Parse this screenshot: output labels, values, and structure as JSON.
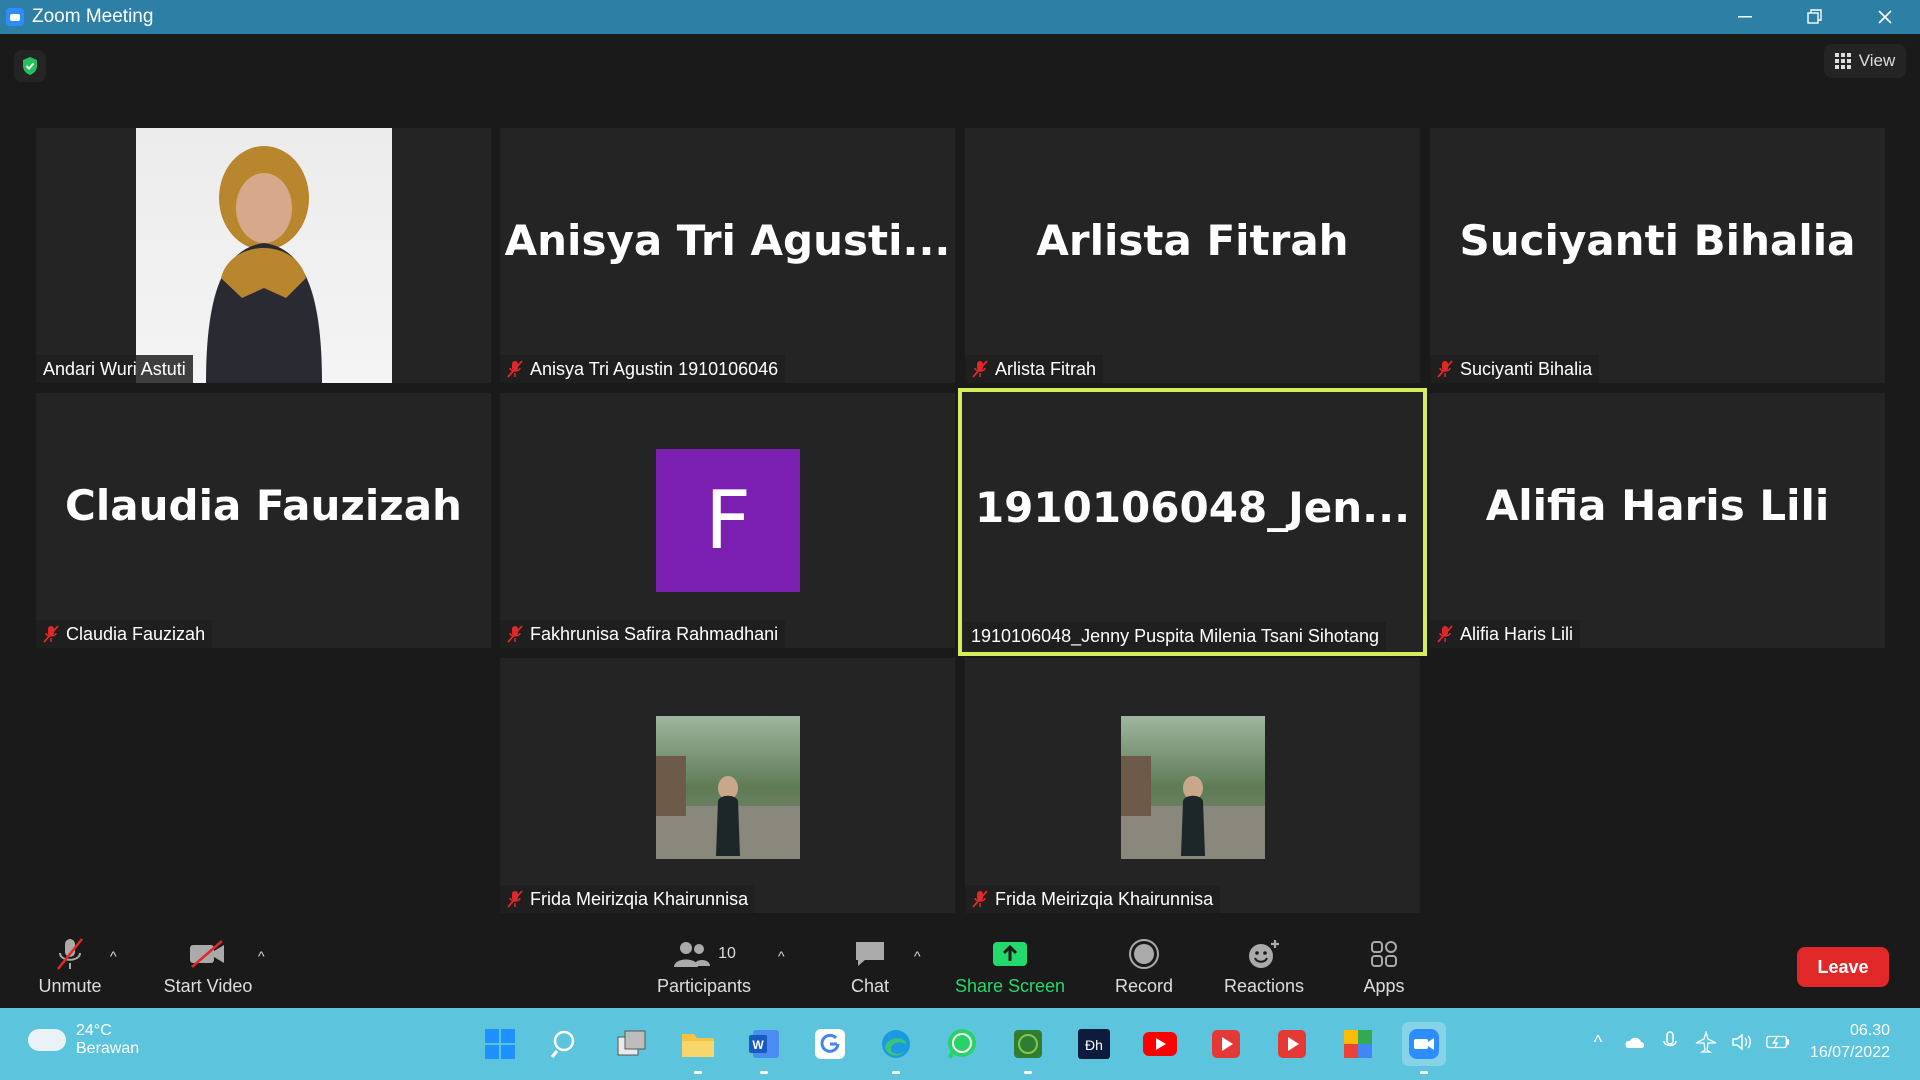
{
  "window": {
    "title": "Zoom Meeting"
  },
  "view_button": {
    "label": "View"
  },
  "tiles": [
    {
      "label": "Andari Wuri Astuti",
      "big_name": ""
    },
    {
      "label": "Anisya Tri Agustin 1910106046",
      "big_name": "Anisya Tri Agusti..."
    },
    {
      "label": "Arlista Fitrah",
      "big_name": "Arlista Fitrah"
    },
    {
      "label": "Suciyanti Bihalia",
      "big_name": "Suciyanti Bihalia"
    },
    {
      "label": "Claudia Fauzizah",
      "big_name": "Claudia Fauzizah"
    },
    {
      "label": "Fakhrunisa Safira Rahmadhani",
      "big_name": "",
      "avatar_letter": "F"
    },
    {
      "label": "1910106048_Jenny Puspita Milenia Tsani Sihotang",
      "big_name": "1910106048_Jen..."
    },
    {
      "label": "Alifia Haris Lili",
      "big_name": "Alifia Haris Lili"
    },
    {
      "label": "Frida Meirizqia Khairunnisa",
      "big_name": ""
    },
    {
      "label": "Frida Meirizqia Khairunnisa",
      "big_name": ""
    }
  ],
  "toolbar": {
    "unmute": "Unmute",
    "start_video": "Start Video",
    "participants": "Participants",
    "participants_count": "10",
    "chat": "Chat",
    "share_screen": "Share Screen",
    "record": "Record",
    "reactions": "Reactions",
    "apps": "Apps",
    "leave": "Leave"
  },
  "taskbar": {
    "weather_temp": "24°C",
    "weather_desc": "Berawan",
    "time": "06.30",
    "date": "16/07/2022"
  },
  "colors": {
    "titlebar": "#2d7fa6",
    "active_speaker": "#d4ed5c",
    "leave": "#e02828",
    "share": "#23d96b",
    "taskbar": "#5cc5dd"
  }
}
